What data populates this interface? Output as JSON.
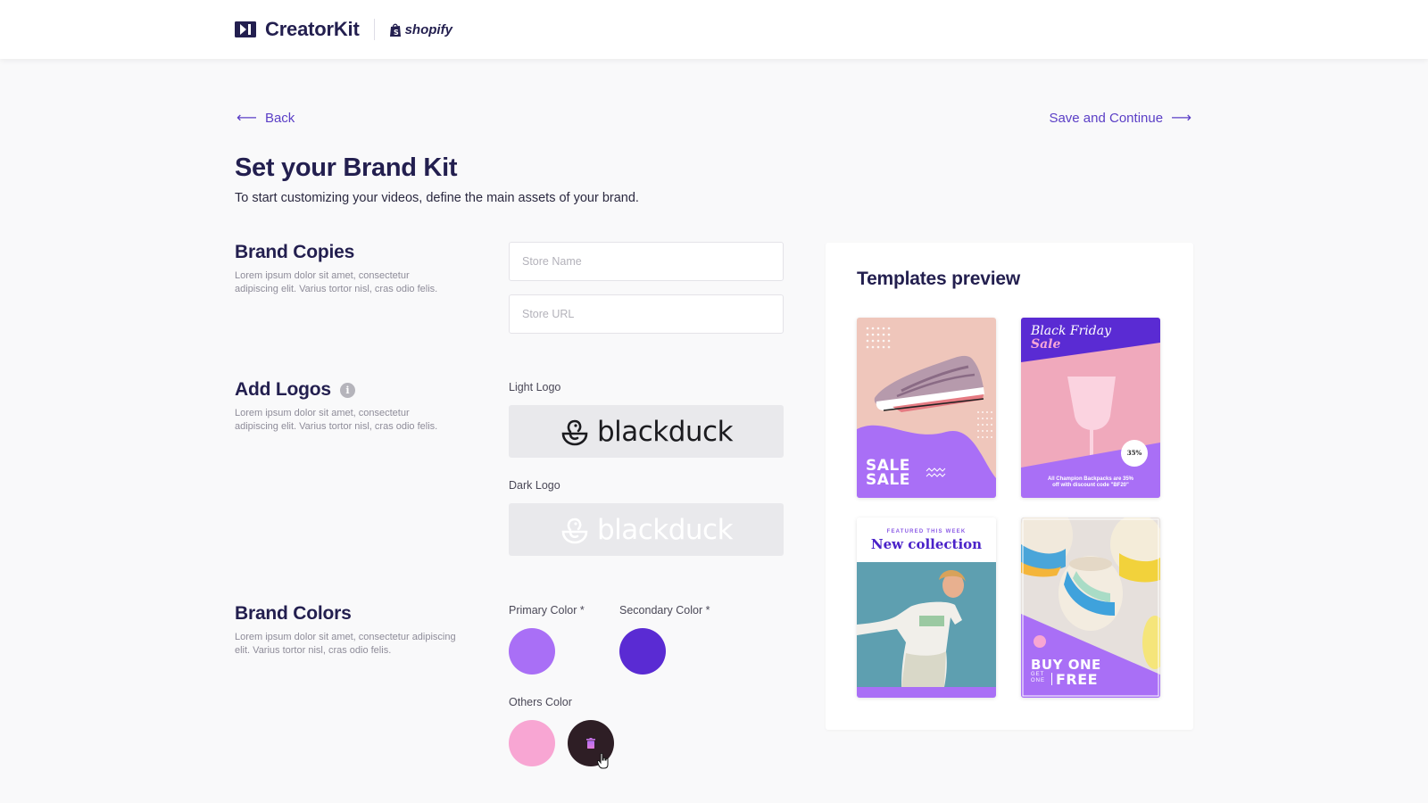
{
  "header": {
    "app_name": "CreatorKit",
    "partner_name": "shopify",
    "app_icon": "play-logo-icon",
    "partner_icon": "shopify-bag-icon"
  },
  "nav": {
    "back_label": "Back",
    "back_icon": "arrow-left-icon",
    "save_label": "Save and Continue",
    "save_icon": "arrow-right-icon"
  },
  "page": {
    "title": "Set your Brand Kit",
    "subtitle": "To start customizing your videos, define the main assets of your brand."
  },
  "sections": {
    "copies": {
      "title": "Brand Copies",
      "description_line1": "Lorem ipsum dolor sit amet, consectetur",
      "description_line2": "adipiscing elit. Varius tortor nisl, cras odio felis.",
      "store_name": {
        "value": "",
        "placeholder": "Store Name"
      },
      "store_url": {
        "value": "",
        "placeholder": "Store URL"
      }
    },
    "logos": {
      "title": "Add Logos",
      "info_icon": "i",
      "description_line1": "Lorem ipsum dolor sit amet, consectetur",
      "description_line2": "adipiscing elit. Varius tortor nisl, cras odio felis.",
      "light_label": "Light Logo",
      "dark_label": "Dark Logo",
      "logo_text": "blackduck"
    },
    "colors": {
      "title": "Brand Colors",
      "description_line1": "Lorem ipsum dolor sit amet, consectetur adipiscing",
      "description_line2": "elit. Varius tortor nisl, cras odio felis.",
      "primary_label": "Primary Color *",
      "secondary_label": "Secondary Color *",
      "others_label": "Others Color",
      "primary_color": "#a96ff6",
      "secondary_color": "#5a2bd3",
      "others_colors": [
        "#f8a6d3",
        "#2e1e25"
      ]
    }
  },
  "preview": {
    "title": "Templates preview",
    "templates": [
      {
        "name": "sneaker-sale",
        "headline": "SALE",
        "headline2": "SALE"
      },
      {
        "name": "black-friday",
        "headline": "Black Friday",
        "headline2": "Sale",
        "promo_line1": "All Champion Backpacks are 35%",
        "promo_line2": "off with discount code \"BF20\"",
        "badge": "35%"
      },
      {
        "name": "new-collection",
        "kicker": "FEATURED THIS WEEK",
        "headline": "New collection"
      },
      {
        "name": "buy-one",
        "headline": "BUY ONE",
        "get_line1": "GET",
        "get_line2": "ONE",
        "headline2": "FREE"
      }
    ]
  },
  "colors": {
    "accent": "#5b3fc6",
    "heading": "#231f4f",
    "background": "#f9f9fa"
  }
}
